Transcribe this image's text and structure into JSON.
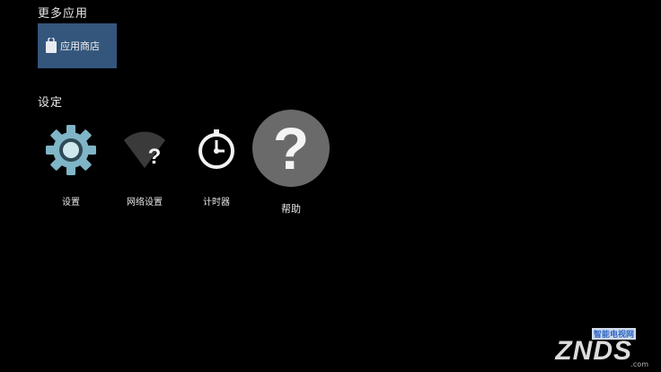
{
  "sections": {
    "more_apps": "更多应用",
    "settings": "设定"
  },
  "apps": [
    {
      "label": "应用商店",
      "icon": "shopping-bag-icon"
    }
  ],
  "settings_items": [
    {
      "label": "设置",
      "icon": "gear-icon"
    },
    {
      "label": "网络设置",
      "icon": "wifi-help-icon"
    },
    {
      "label": "计时器",
      "icon": "timer-icon"
    },
    {
      "label": "帮助",
      "icon": "question-icon"
    }
  ],
  "watermark": {
    "top": "智能电视网",
    "main": "ZNDS",
    "suffix": ".com"
  },
  "colors": {
    "background": "#000000",
    "app_tile": "#34567c",
    "gear": "#7fb5c6",
    "help_circle": "#6a6a6a"
  }
}
